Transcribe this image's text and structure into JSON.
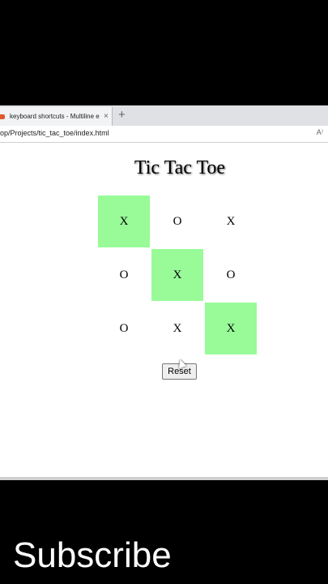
{
  "browser": {
    "tab_title": "keyboard shortcuts - Multiline e",
    "tab_close": "×",
    "new_tab": "+",
    "url": "op/Projects/tic_tac_toe/index.html",
    "read_aloud": "A⁾"
  },
  "game": {
    "title": "Tic Tac Toe",
    "cells": [
      "X",
      "O",
      "X",
      "O",
      "X",
      "O",
      "O",
      "X",
      "X"
    ],
    "winning_cells": [
      0,
      4,
      8
    ],
    "win_color": "#98fb98",
    "reset_label": "Reset"
  },
  "overlay": {
    "subscribe": "Subscribe"
  }
}
